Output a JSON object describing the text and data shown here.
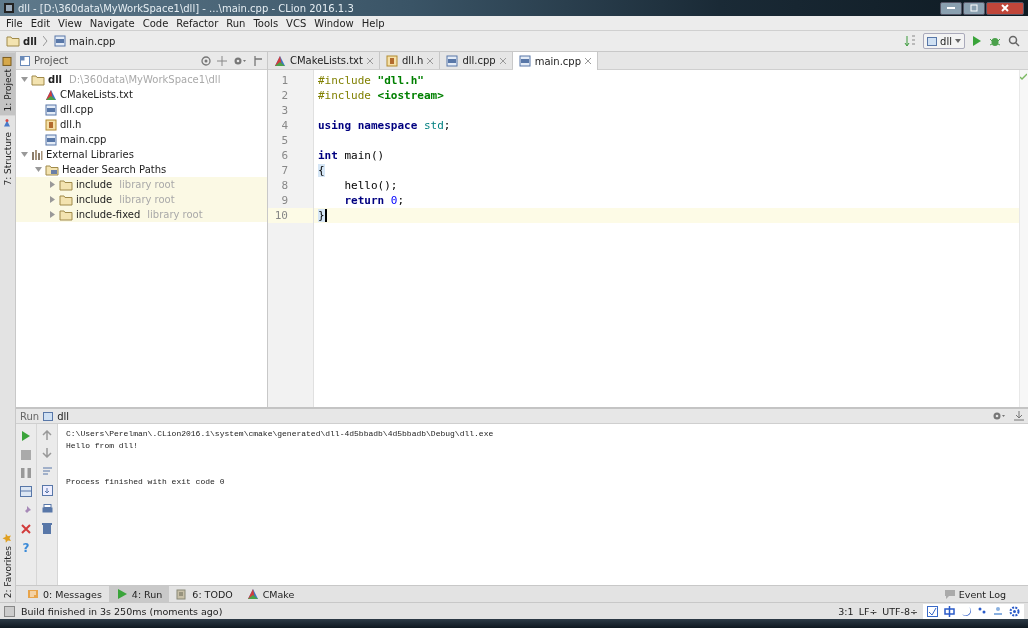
{
  "window": {
    "title": "dll - [D:\\360data\\MyWorkSpace1\\dll] - ...\\main.cpp - CLion 2016.1.3"
  },
  "menu": [
    "File",
    "Edit",
    "View",
    "Navigate",
    "Code",
    "Refactor",
    "Run",
    "Tools",
    "VCS",
    "Window",
    "Help"
  ],
  "breadcrumbs": [
    {
      "label": "dll",
      "kind": "folder"
    },
    {
      "label": "main.cpp",
      "kind": "cpp"
    }
  ],
  "toolbar": {
    "run_config": "dll"
  },
  "side_tabs_top": [
    {
      "label": "1: Project",
      "selected": true
    },
    {
      "label": "7: Structure",
      "selected": false
    }
  ],
  "side_tabs_bottom": [
    {
      "label": "2: Favorites",
      "selected": false
    }
  ],
  "project": {
    "title": "Project",
    "tree": [
      {
        "label": "dll",
        "hint": "D:\\360data\\MyWorkSpace1\\dll",
        "kind": "module",
        "expanded": true,
        "children": [
          {
            "label": "CMakeLists.txt",
            "kind": "cmake"
          },
          {
            "label": "dll.cpp",
            "kind": "cpp"
          },
          {
            "label": "dll.h",
            "kind": "header"
          },
          {
            "label": "main.cpp",
            "kind": "cpp"
          }
        ]
      },
      {
        "label": "External Libraries",
        "kind": "libs",
        "expanded": true,
        "children": [
          {
            "label": "Header Search Paths",
            "kind": "libfolder",
            "expanded": true,
            "children": [
              {
                "label": "include",
                "hint": "library root",
                "kind": "library_root",
                "expanded": false
              },
              {
                "label": "include",
                "hint": "library root",
                "kind": "library_root",
                "expanded": false
              },
              {
                "label": "include-fixed",
                "hint": "library root",
                "kind": "library_root",
                "expanded": false
              }
            ]
          }
        ]
      }
    ]
  },
  "editor_tabs": [
    {
      "label": "CMakeLists.txt",
      "kind": "cmake",
      "selected": false
    },
    {
      "label": "dll.h",
      "kind": "header",
      "selected": false
    },
    {
      "label": "dll.cpp",
      "kind": "cpp",
      "selected": false
    },
    {
      "label": "main.cpp",
      "kind": "cpp",
      "selected": true
    }
  ],
  "code": [
    {
      "number": "1",
      "current": false,
      "tokens": [
        {
          "text": "#include ",
          "kind": "directive"
        },
        {
          "text": "\"dll.h\"",
          "kind": "string"
        }
      ]
    },
    {
      "number": "2",
      "current": false,
      "tokens": [
        {
          "text": "#include ",
          "kind": "directive"
        },
        {
          "text": "<iostream>",
          "kind": "string"
        }
      ]
    },
    {
      "number": "3",
      "current": false
    },
    {
      "number": "4",
      "current": false,
      "tokens": [
        {
          "text": "using namespace ",
          "kind": "keyword"
        },
        {
          "text": "std",
          "kind": "namespace"
        },
        {
          "text": ";",
          "kind": "plain"
        }
      ]
    },
    {
      "number": "5",
      "current": false
    },
    {
      "number": "6",
      "current": false,
      "tokens": [
        {
          "text": "int ",
          "kind": "keyword"
        },
        {
          "text": "main()",
          "kind": "plain"
        }
      ]
    },
    {
      "number": "7",
      "current": false,
      "tokens": [
        {
          "text": "{",
          "kind": "brace"
        }
      ]
    },
    {
      "number": "8",
      "current": false,
      "tokens": [
        {
          "text": "    hello();",
          "kind": "plain"
        }
      ]
    },
    {
      "number": "9",
      "current": false,
      "tokens": [
        {
          "text": "    return ",
          "kind": "keyword"
        },
        {
          "text": "0",
          "kind": "number"
        },
        {
          "text": ";",
          "kind": "plain"
        }
      ]
    },
    {
      "number": "10",
      "current": true,
      "tokens": [
        {
          "text": "}",
          "kind": "brace"
        }
      ]
    }
  ],
  "run_panel": {
    "title": "Run",
    "config": "dll",
    "help": "?",
    "command": "C:\\Users\\Perelman\\.CLion2016.1\\system\\cmake\\generated\\dll-4d5bbadb\\4d5bbadb\\Debug\\dll.exe",
    "output": [
      "Hello from dll!"
    ],
    "exit_message": "Process finished with exit code 0"
  },
  "tool_tabs": [
    {
      "label": "0: Messages",
      "kind": "messages",
      "selected": false
    },
    {
      "label": "4: Run",
      "kind": "run",
      "selected": true
    },
    {
      "label": "6: TODO",
      "kind": "todo",
      "selected": false
    },
    {
      "label": "CMake",
      "kind": "cmake",
      "selected": false
    }
  ],
  "event_log": "Event Log",
  "status_bar": {
    "message": "Build finished in 3s 250ms (moments ago)",
    "position": "3:1",
    "line_separator": "LF÷",
    "encoding": "UTF-8÷"
  }
}
